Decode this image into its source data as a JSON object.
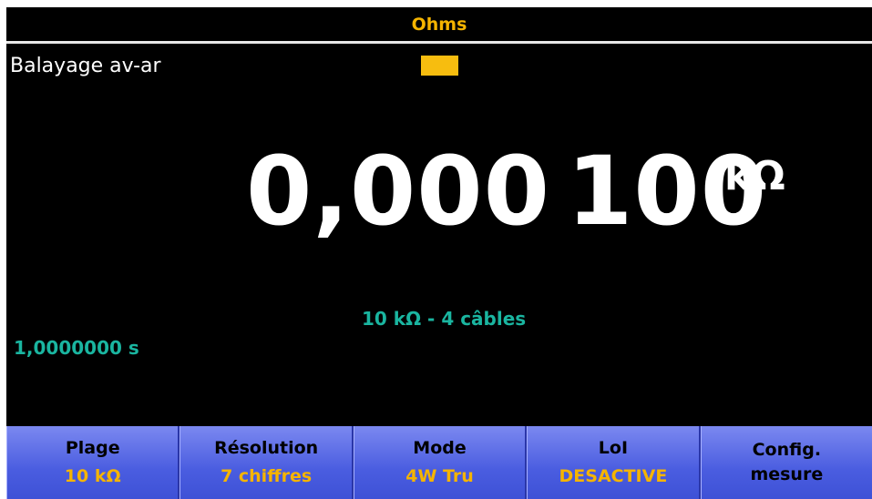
{
  "header": {
    "title": "Ohms"
  },
  "display": {
    "sweep_label": "Balayage av-ar",
    "status_indicator_color": "#f7bd0f",
    "reading_main": "0,000",
    "reading_low": "100",
    "unit": "kΩ",
    "range_info": "10 kΩ - 4 câbles",
    "aperture": "1,0000000 s"
  },
  "softkeys": [
    {
      "label": "Plage",
      "value": "10 kΩ"
    },
    {
      "label": "Résolution",
      "value": "7 chiffres"
    },
    {
      "label": "Mode",
      "value": "4W Tru"
    },
    {
      "label": "LoI",
      "value": "DESACTIVE"
    },
    {
      "label": "Config.",
      "label2": "mesure"
    }
  ],
  "colors": {
    "accent": "#f5b400",
    "info": "#1ab5a0",
    "softkey": "#4a5de0",
    "background": "#000000"
  }
}
